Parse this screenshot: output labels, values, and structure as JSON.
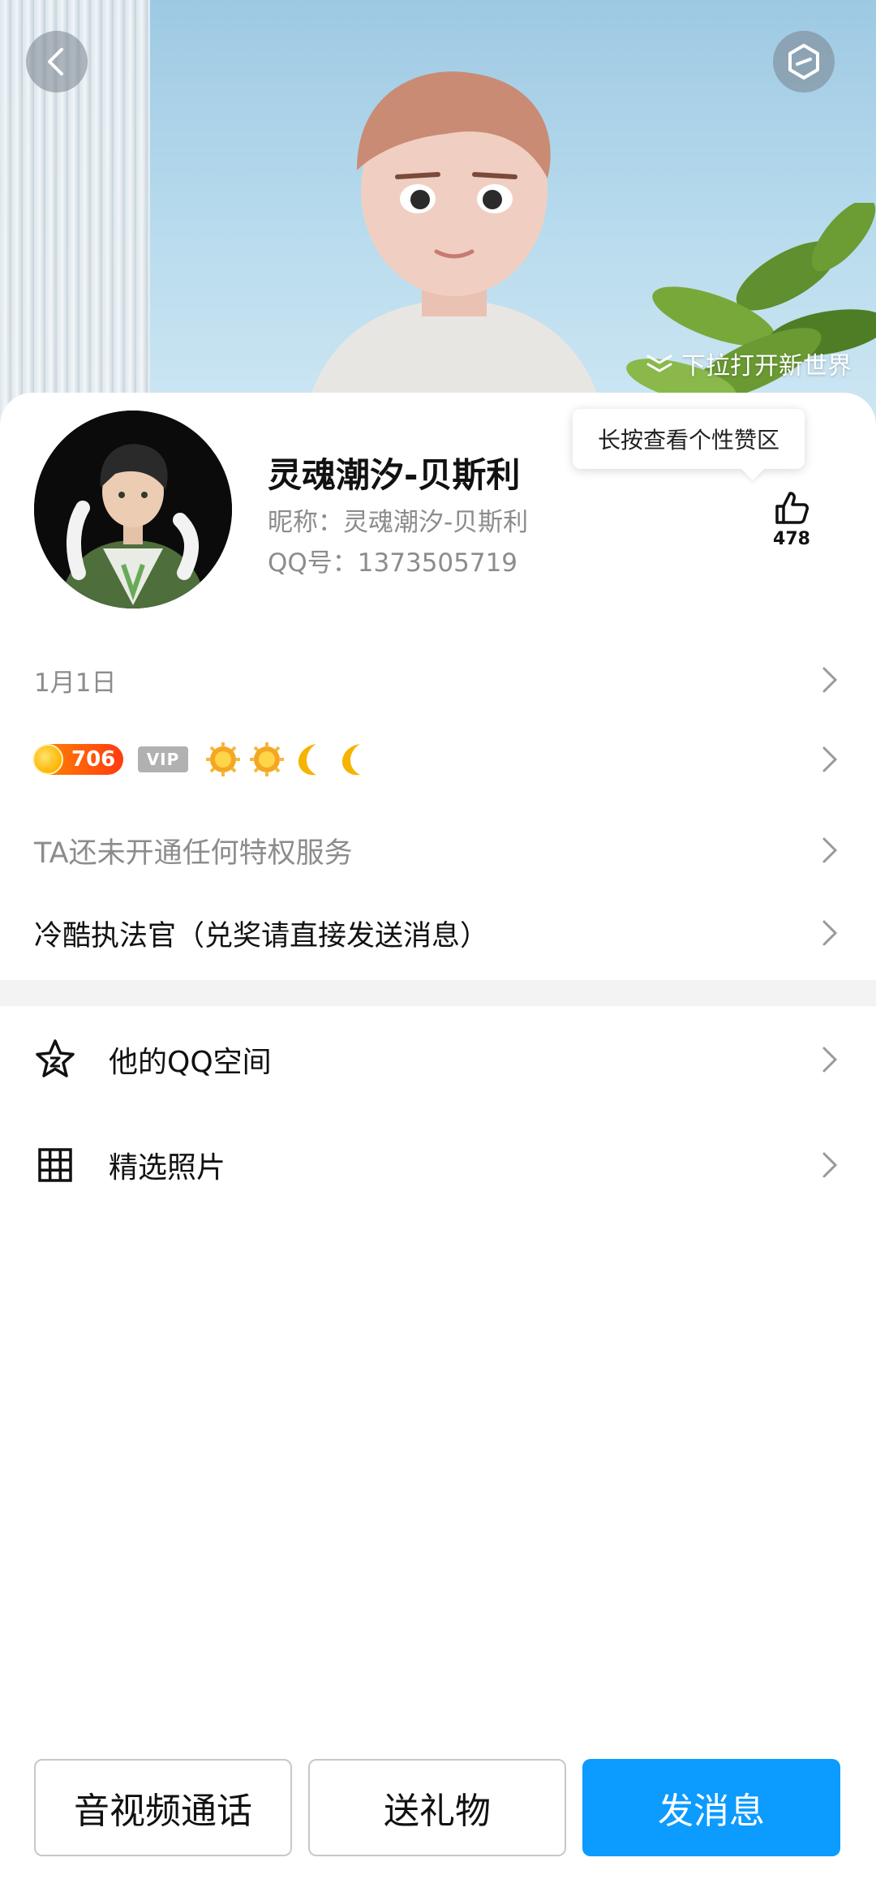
{
  "header": {
    "pull_hint": "下拉打开新世界",
    "icons": {
      "back": "chevron-left-icon",
      "more": "hexagon-icon",
      "pull": "chevron-down-double-icon"
    }
  },
  "profile": {
    "display_name": "灵魂潮汐-贝斯利",
    "nickname_line": "昵称：灵魂潮汐-贝斯利",
    "qq_line": "QQ号：1373505719",
    "like_tooltip": "长按查看个性赞区",
    "like_count": "478"
  },
  "rows": {
    "birthday": "1月1日",
    "coin_value": "706",
    "vip_label": "VIP",
    "level_icons": [
      "sun-icon",
      "sun-icon",
      "moon-icon",
      "moon-icon"
    ],
    "privilege_text": "TA还未开通任何特权服务",
    "signature_text": "冷酷执法官（兑奖请直接发送消息）"
  },
  "menu": {
    "qzone_label": "他的QQ空间",
    "photos_label": "精选照片"
  },
  "actions": {
    "call_label": "音视频通话",
    "gift_label": "送礼物",
    "message_label": "发消息"
  },
  "colors": {
    "primary_button": "#0c9bff",
    "coin_badge": "#ff5a12",
    "vip_badge": "#b1b1b1"
  }
}
